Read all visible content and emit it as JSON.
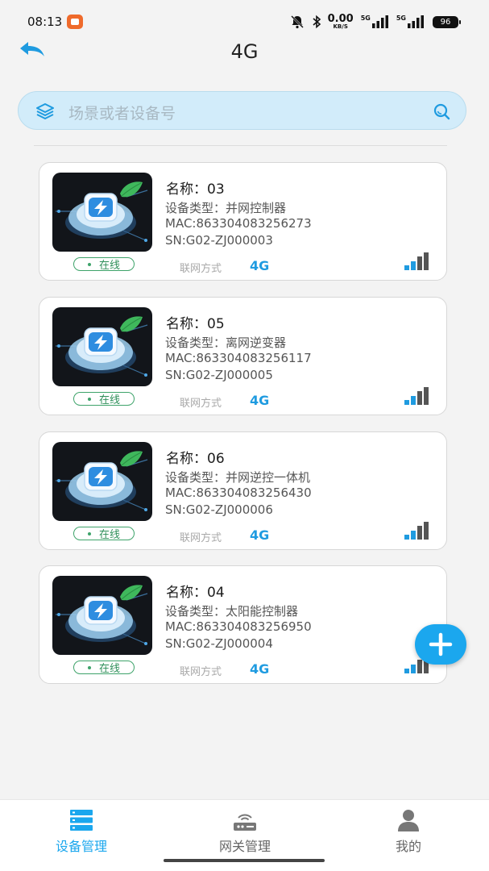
{
  "status_bar": {
    "time": "08:13",
    "net_speed_value": "0.00",
    "net_speed_unit": "KB/S",
    "signal1_label": "5G",
    "signal2_label": "5G",
    "battery": "96"
  },
  "header": {
    "title": "4G"
  },
  "search": {
    "placeholder": "场景或者设备号"
  },
  "devices": [
    {
      "name": "名称：03",
      "type": "设备类型：并网控制器",
      "mac": "MAC:863304083256273",
      "sn": "SN:G02-ZJ000003",
      "status": "在线",
      "net_label": "联网方式",
      "net_value": "4G"
    },
    {
      "name": "名称：05",
      "type": "设备类型：离网逆变器",
      "mac": "MAC:863304083256117",
      "sn": "SN:G02-ZJ000005",
      "status": "在线",
      "net_label": "联网方式",
      "net_value": "4G"
    },
    {
      "name": "名称：06",
      "type": "设备类型：并网逆控一体机",
      "mac": "MAC:863304083256430",
      "sn": "SN:G02-ZJ000006",
      "status": "在线",
      "net_label": "联网方式",
      "net_value": "4G"
    },
    {
      "name": "名称：04",
      "type": "设备类型：太阳能控制器",
      "mac": "MAC:863304083256950",
      "sn": "SN:G02-ZJ000004",
      "status": "在线",
      "net_label": "联网方式",
      "net_value": "4G"
    }
  ],
  "bottom_nav": {
    "items": [
      {
        "label": "设备管理",
        "icon": "device-list-icon",
        "active": true
      },
      {
        "label": "网关管理",
        "icon": "router-icon",
        "active": false
      },
      {
        "label": "我的",
        "icon": "user-icon",
        "active": false
      }
    ]
  },
  "colors": {
    "accent": "#1ba7ee",
    "online": "#3ea36a",
    "search_bg": "#d2ecfa"
  }
}
